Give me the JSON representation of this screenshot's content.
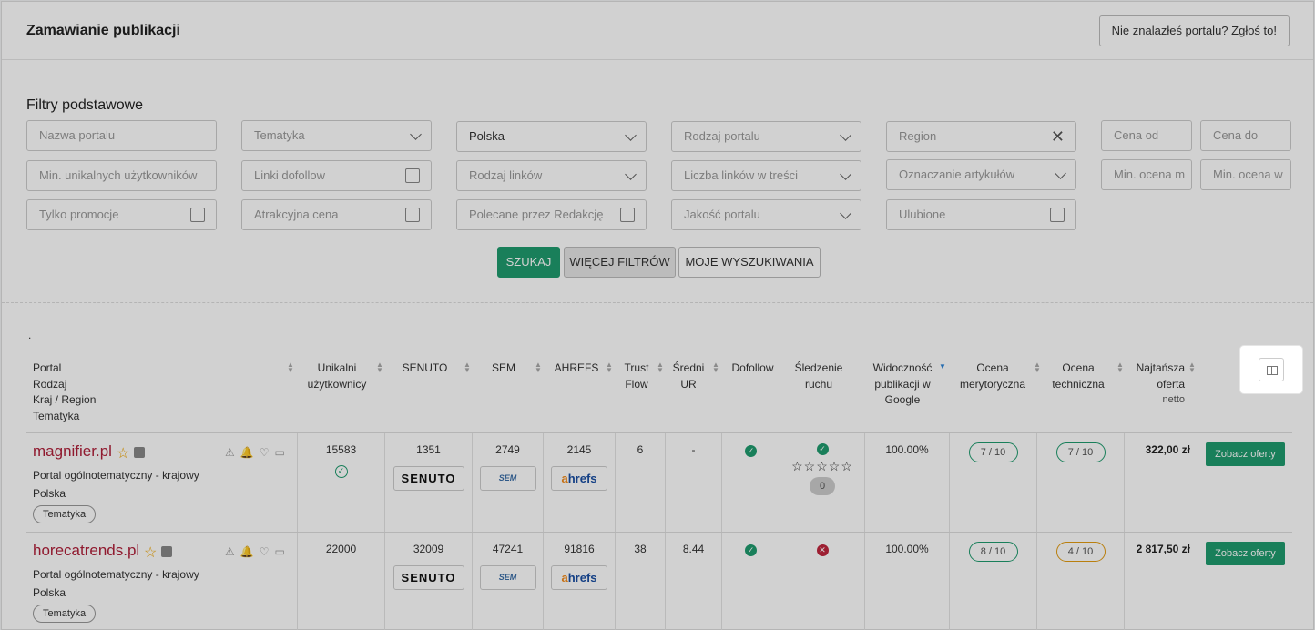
{
  "header": {
    "title": "Zamawianie publikacji",
    "report_button": "Nie znalazłeś portalu? Zgłoś to!"
  },
  "filters": {
    "title": "Filtry podstawowe",
    "portal_name_placeholder": "Nazwa portalu",
    "topic": "Tematyka",
    "country": "Polska",
    "portal_type": "Rodzaj portalu",
    "region": "Region",
    "price_from": "Cena od",
    "price_to": "Cena do",
    "min_unique_users": "Min. unikalnych użytkowników",
    "dofollow_links": "Linki dofollow",
    "link_type": "Rodzaj linków",
    "links_in_content": "Liczba linków w treści",
    "article_marking": "Oznaczanie artykułów",
    "min_rating_1": "Min. ocena m",
    "min_rating_2": "Min. ocena w",
    "promotions_only": "Tylko promocje",
    "attractive_price": "Atrakcyjna cena",
    "recommended": "Polecane przez Redakcję",
    "portal_quality": "Jakość portalu",
    "favorites": "Ulubione"
  },
  "buttons": {
    "search": "SZUKAJ",
    "more_filters": "WIĘCEJ FILTRÓW",
    "my_searches": "MOJE WYSZUKIWANIA"
  },
  "dot_text": ".",
  "table": {
    "headers": {
      "portal_1": "Portal",
      "portal_2": "Rodzaj",
      "portal_3": "Kraj / Region",
      "portal_4": "Tematyka",
      "unique_1": "Unikalni",
      "unique_2": "użytkownicy",
      "senuto": "SENUTO",
      "sem": "SEM",
      "ahrefs": "AHREFS",
      "trust_1": "Trust",
      "trust_2": "Flow",
      "ur_1": "Średni",
      "ur_2": "UR",
      "dofollow": "Dofollow",
      "track_1": "Śledzenie",
      "track_2": "ruchu",
      "vis_1": "Widoczność",
      "vis_2": "publikacji w",
      "vis_3": "Google",
      "merit_1": "Ocena",
      "merit_2": "merytoryczna",
      "tech_1": "Ocena",
      "tech_2": "techniczna",
      "best_1": "Najtańsza",
      "best_2": "oferta",
      "best_3": "netto"
    },
    "rows": [
      {
        "name": "magnifier.pl",
        "type": "Portal ogólnotematyczny - krajowy",
        "country": "Polska",
        "tag": "Tematyka",
        "unique": "15583",
        "senuto": "1351",
        "sem": "2749",
        "ahrefs": "2145",
        "trust": "6",
        "ur": "-",
        "visibility": "100.00%",
        "merit": "7 / 10",
        "tech": "7 / 10",
        "price": "322,00 zł",
        "offer": "Zobacz oferty",
        "tracking_count": "0"
      },
      {
        "name": "horecatrends.pl",
        "type": "Portal ogólnotematyczny - krajowy",
        "country": "Polska",
        "tag": "Tematyka",
        "unique": "22000",
        "senuto": "32009",
        "sem": "47241",
        "ahrefs": "91816",
        "trust": "38",
        "ur": "8.44",
        "visibility": "100.00%",
        "merit": "8 / 10",
        "tech": "4 / 10",
        "price": "2 817,50 zł",
        "offer": "Zobacz oferty"
      }
    ],
    "logos": {
      "senuto": "SENUTO",
      "sem": "SEM",
      "ahrefs_a": "a",
      "ahrefs_rest": "hrefs"
    }
  },
  "colors": {
    "accent": "#1f9b6e",
    "portal_link": "#b0203a",
    "warning": "#e29b12",
    "error": "#c0263d"
  }
}
